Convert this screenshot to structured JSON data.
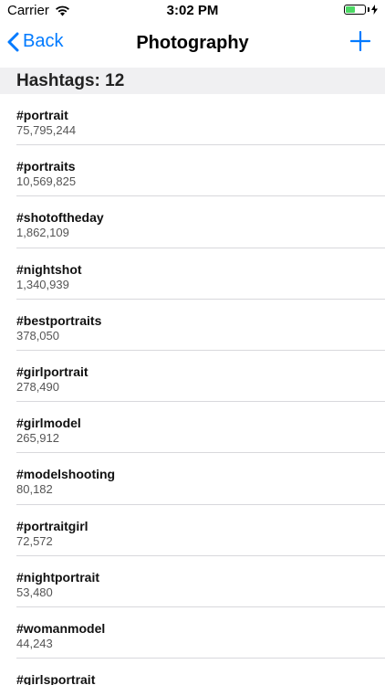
{
  "status_bar": {
    "carrier": "Carrier",
    "time": "3:02 PM",
    "battery_level": 0.55
  },
  "nav": {
    "back_label": "Back",
    "title": "Photography"
  },
  "section": {
    "title": "Hashtags: 12"
  },
  "hashtags": [
    {
      "tag": "#portrait",
      "count": "75,795,244"
    },
    {
      "tag": "#portraits",
      "count": "10,569,825"
    },
    {
      "tag": "#shotoftheday",
      "count": "1,862,109"
    },
    {
      "tag": "#nightshot",
      "count": "1,340,939"
    },
    {
      "tag": "#bestportraits",
      "count": "378,050"
    },
    {
      "tag": "#girlportrait",
      "count": "278,490"
    },
    {
      "tag": "#girlmodel",
      "count": "265,912"
    },
    {
      "tag": "#modelshooting",
      "count": "80,182"
    },
    {
      "tag": "#portraitgirl",
      "count": "72,572"
    },
    {
      "tag": "#nightportrait",
      "count": "53,480"
    },
    {
      "tag": "#womanmodel",
      "count": "44,243"
    },
    {
      "tag": "#girlsportrait",
      "count": ""
    }
  ],
  "colors": {
    "accent": "#007aff",
    "battery": "#4cd964",
    "header_bg": "#f0f0f2"
  }
}
